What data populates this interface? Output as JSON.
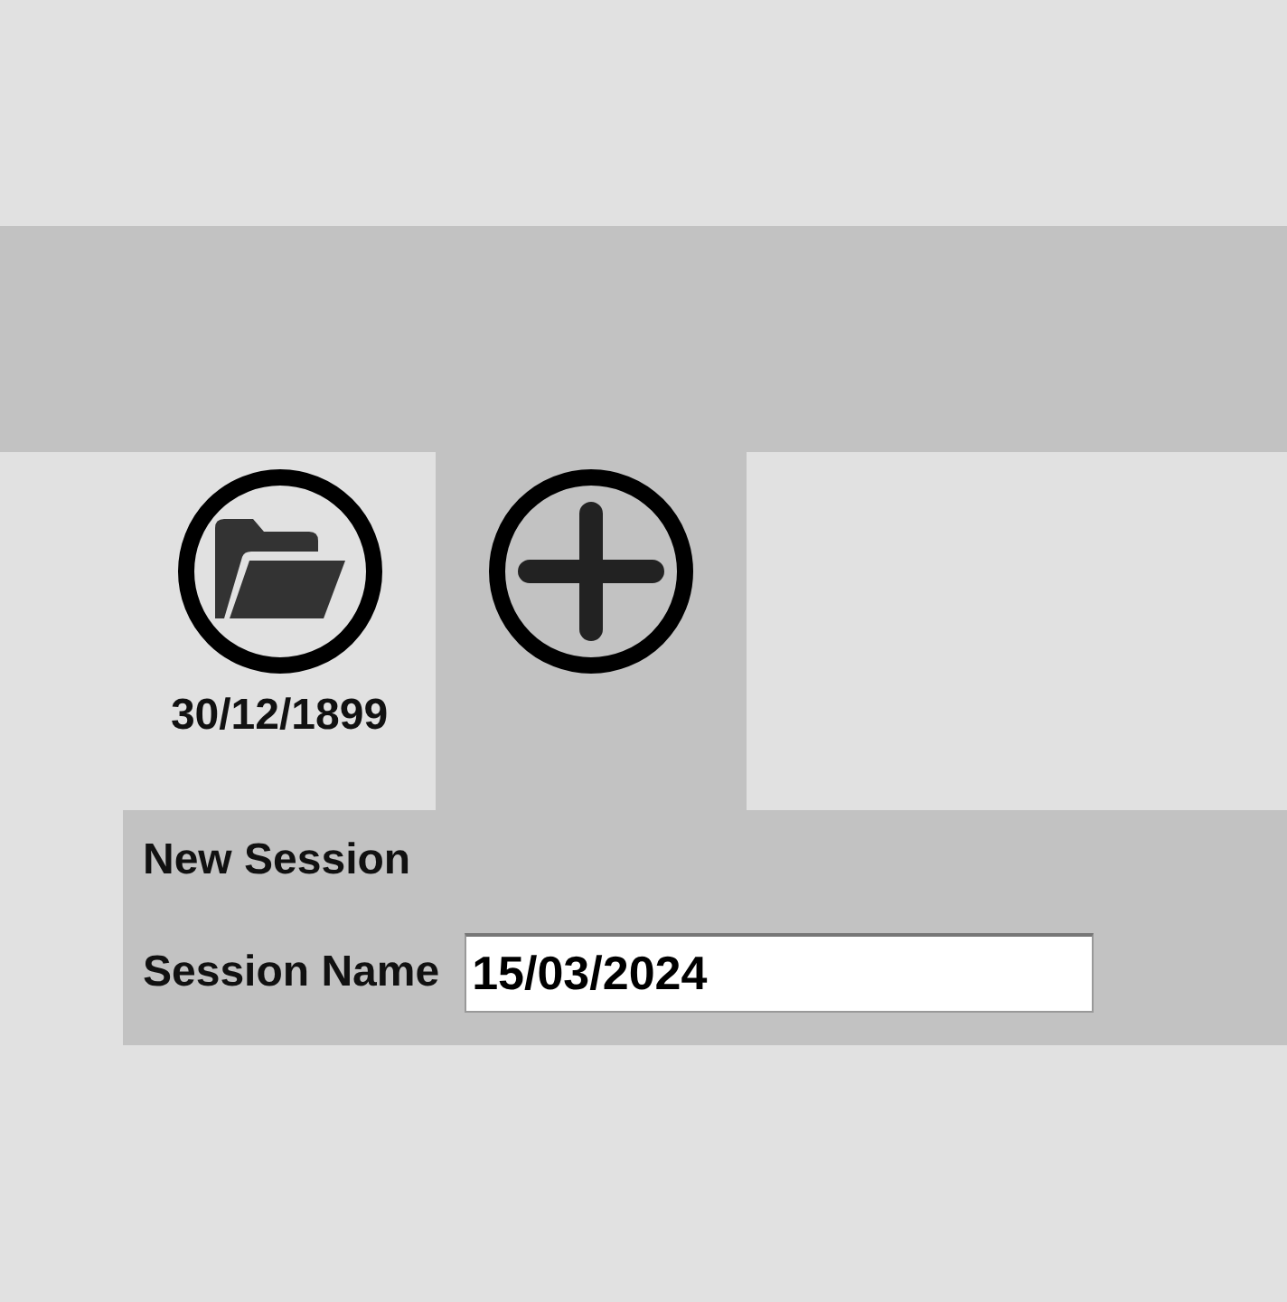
{
  "tiles": [
    {
      "kind": "session",
      "label": "30/12/1899",
      "selected": false
    },
    {
      "kind": "new",
      "selected": true
    }
  ],
  "panel": {
    "title": "New Session",
    "field_label": "Session Name",
    "field_value": "15/03/2024"
  }
}
